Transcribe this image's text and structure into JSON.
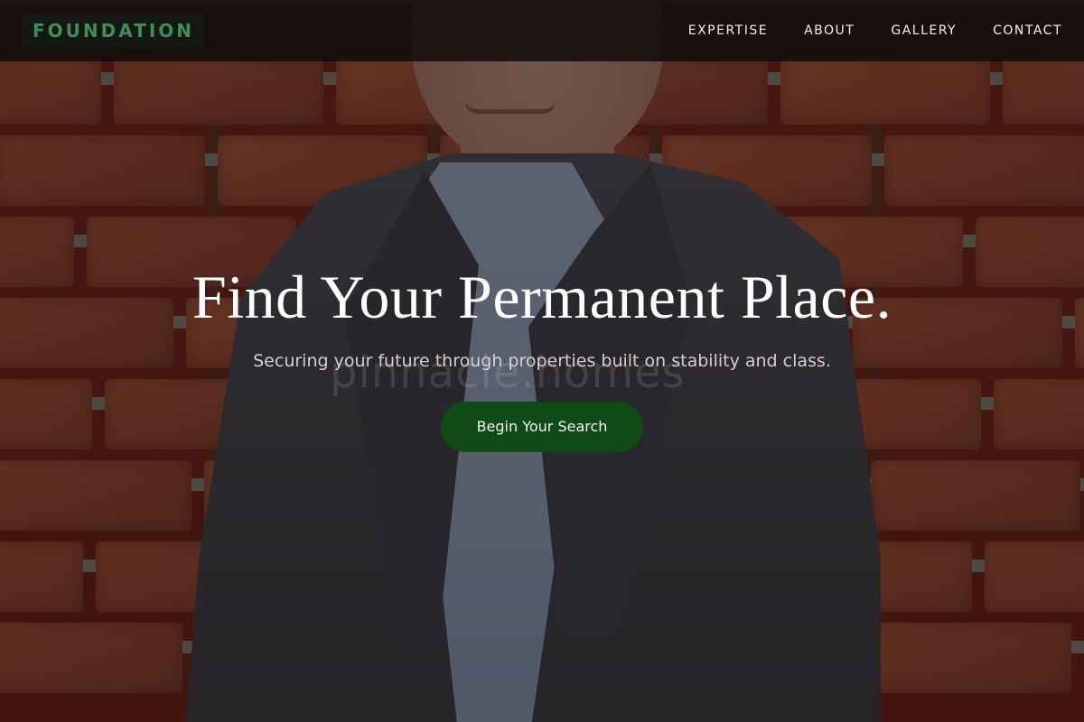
{
  "nav": {
    "logo": "FOUNDATION",
    "items": [
      {
        "label": "EXPERTISE"
      },
      {
        "label": "ABOUT"
      },
      {
        "label": "GALLERY"
      },
      {
        "label": "CONTACT"
      }
    ]
  },
  "hero": {
    "title": "Find Your Permanent Place.",
    "subtitle": "Securing your future through properties built on stability and class.",
    "cta_label": "Begin Your Search",
    "watermark": "pinnacle.homes"
  },
  "colors": {
    "brand_green": "#3f8f52",
    "cta_green": "#104a17",
    "nav_bg": "#120e0e"
  }
}
